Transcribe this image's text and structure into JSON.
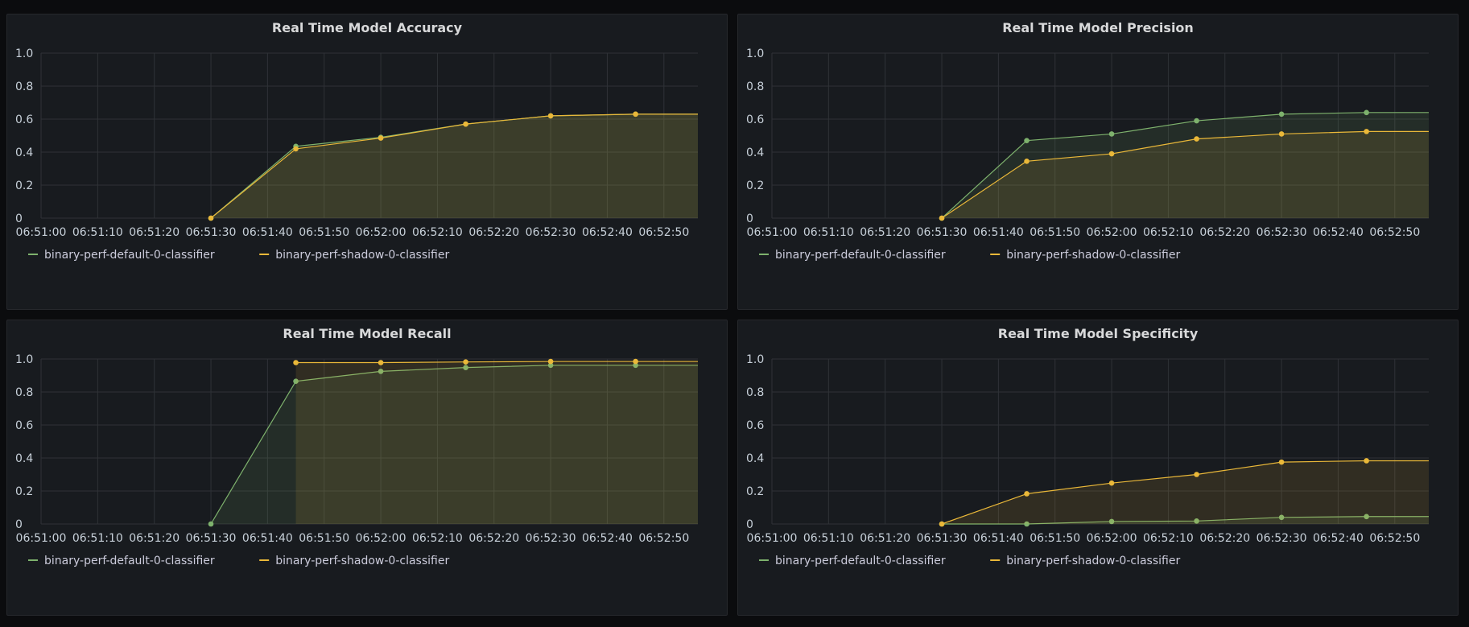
{
  "palette": {
    "default_series": "#7eb26d",
    "shadow_series": "#eab839",
    "panel_bg": "#181b1f",
    "page_bg": "#0b0c0e"
  },
  "chart_data": [
    {
      "type": "line",
      "title": "Real Time Model Accuracy",
      "x": [
        "06:51:30",
        "06:51:45",
        "06:52:00",
        "06:52:15",
        "06:52:30",
        "06:52:45"
      ],
      "x_ticks": [
        "06:51:00",
        "06:51:10",
        "06:51:20",
        "06:51:30",
        "06:51:40",
        "06:51:50",
        "06:52:00",
        "06:52:10",
        "06:52:20",
        "06:52:30",
        "06:52:40",
        "06:52:50"
      ],
      "x_range": [
        "06:51:00",
        "06:52:56"
      ],
      "y_ticks": [
        "0",
        "0.2",
        "0.4",
        "0.6",
        "0.8",
        "1.0"
      ],
      "ylim": [
        0,
        1
      ],
      "grid": true,
      "legend_position": "bottom-left",
      "series": [
        {
          "name": "binary-perf-default-0-classifier",
          "color": "#7eb26d",
          "start": 0,
          "values": [
            0,
            0.435,
            0.49,
            0.57,
            0.62,
            0.63
          ]
        },
        {
          "name": "binary-perf-shadow-0-classifier",
          "color": "#eab839",
          "start": 0,
          "values": [
            0,
            0.42,
            0.485,
            0.57,
            0.62,
            0.63
          ]
        }
      ]
    },
    {
      "type": "line",
      "title": "Real Time Model Precision",
      "x": [
        "06:51:30",
        "06:51:45",
        "06:52:00",
        "06:52:15",
        "06:52:30",
        "06:52:45"
      ],
      "x_ticks": [
        "06:51:00",
        "06:51:10",
        "06:51:20",
        "06:51:30",
        "06:51:40",
        "06:51:50",
        "06:52:00",
        "06:52:10",
        "06:52:20",
        "06:52:30",
        "06:52:40",
        "06:52:50"
      ],
      "x_range": [
        "06:51:00",
        "06:52:56"
      ],
      "y_ticks": [
        "0",
        "0.2",
        "0.4",
        "0.6",
        "0.8",
        "1.0"
      ],
      "ylim": [
        0,
        1
      ],
      "grid": true,
      "legend_position": "bottom-left",
      "series": [
        {
          "name": "binary-perf-default-0-classifier",
          "color": "#7eb26d",
          "start": 0,
          "values": [
            0,
            0.47,
            0.51,
            0.59,
            0.63,
            0.64
          ]
        },
        {
          "name": "binary-perf-shadow-0-classifier",
          "color": "#eab839",
          "start": 0,
          "values": [
            0,
            0.345,
            0.39,
            0.48,
            0.51,
            0.525
          ]
        }
      ]
    },
    {
      "type": "line",
      "title": "Real Time Model Recall",
      "x": [
        "06:51:30",
        "06:51:45",
        "06:52:00",
        "06:52:15",
        "06:52:30",
        "06:52:45"
      ],
      "x_ticks": [
        "06:51:00",
        "06:51:10",
        "06:51:20",
        "06:51:30",
        "06:51:40",
        "06:51:50",
        "06:52:00",
        "06:52:10",
        "06:52:20",
        "06:52:30",
        "06:52:40",
        "06:52:50"
      ],
      "x_range": [
        "06:51:00",
        "06:52:56"
      ],
      "y_ticks": [
        "0",
        "0.2",
        "0.4",
        "0.6",
        "0.8",
        "1.0"
      ],
      "ylim": [
        0,
        1
      ],
      "grid": true,
      "legend_position": "bottom-left",
      "series": [
        {
          "name": "binary-perf-default-0-classifier",
          "color": "#7eb26d",
          "start": 0,
          "values": [
            0,
            0.865,
            0.925,
            0.948,
            0.962,
            0.962
          ]
        },
        {
          "name": "binary-perf-shadow-0-classifier",
          "color": "#eab839",
          "start": 1,
          "values": [
            0.978,
            0.978,
            0.982,
            0.985,
            0.985
          ]
        }
      ]
    },
    {
      "type": "line",
      "title": "Real Time Model Specificity",
      "x": [
        "06:51:30",
        "06:51:45",
        "06:52:00",
        "06:52:15",
        "06:52:30",
        "06:52:45"
      ],
      "x_ticks": [
        "06:51:00",
        "06:51:10",
        "06:51:20",
        "06:51:30",
        "06:51:40",
        "06:51:50",
        "06:52:00",
        "06:52:10",
        "06:52:20",
        "06:52:30",
        "06:52:40",
        "06:52:50"
      ],
      "x_range": [
        "06:51:00",
        "06:52:56"
      ],
      "y_ticks": [
        "0",
        "0.2",
        "0.4",
        "0.6",
        "0.8",
        "1.0"
      ],
      "ylim": [
        0,
        1
      ],
      "grid": true,
      "legend_position": "bottom-left",
      "series": [
        {
          "name": "binary-perf-default-0-classifier",
          "color": "#7eb26d",
          "start": 0,
          "values": [
            0,
            0,
            0.015,
            0.018,
            0.04,
            0.045
          ]
        },
        {
          "name": "binary-perf-shadow-0-classifier",
          "color": "#eab839",
          "start": 0,
          "values": [
            0,
            0.183,
            0.248,
            0.3,
            0.375,
            0.383
          ]
        }
      ]
    }
  ]
}
